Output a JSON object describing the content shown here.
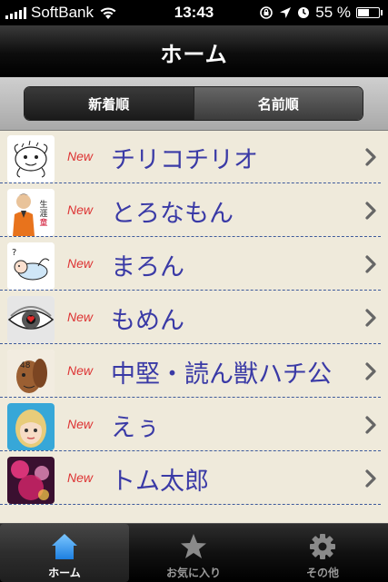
{
  "status_bar": {
    "carrier": "SoftBank",
    "time": "13:43",
    "battery_percent": "55 %",
    "battery_level": 0.55
  },
  "nav": {
    "title": "ホーム"
  },
  "segments": [
    {
      "label": "新着順",
      "selected": true
    },
    {
      "label": "名前順",
      "selected": false
    }
  ],
  "list": {
    "items": [
      {
        "badge": "New",
        "name": "チリコチリオ",
        "avatar": "doodle-creature"
      },
      {
        "badge": "New",
        "name": "とろなもん",
        "avatar": "guy-orange-shirt"
      },
      {
        "badge": "New",
        "name": "まろん",
        "avatar": "lying-baby-doodle"
      },
      {
        "badge": "New",
        "name": "もめん",
        "avatar": "eye-heart"
      },
      {
        "badge": "New",
        "name": "中堅・読ん獣ハチ公",
        "avatar": "brown-dog-48"
      },
      {
        "badge": "New",
        "name": "えぅ",
        "avatar": "blonde-avatar"
      },
      {
        "badge": "New",
        "name": "トム太郎",
        "avatar": "neon-pink-photo"
      }
    ]
  },
  "tabbar": {
    "tabs": [
      {
        "label": "ホーム",
        "icon": "home-icon",
        "active": true
      },
      {
        "label": "お気に入り",
        "icon": "star-icon",
        "active": false
      },
      {
        "label": "その他",
        "icon": "gear-icon",
        "active": false
      }
    ]
  },
  "colors": {
    "list_background": "#efeadb",
    "name_text": "#3a3aa6",
    "new_badge": "#d33",
    "divider": "#3d5a9b"
  }
}
